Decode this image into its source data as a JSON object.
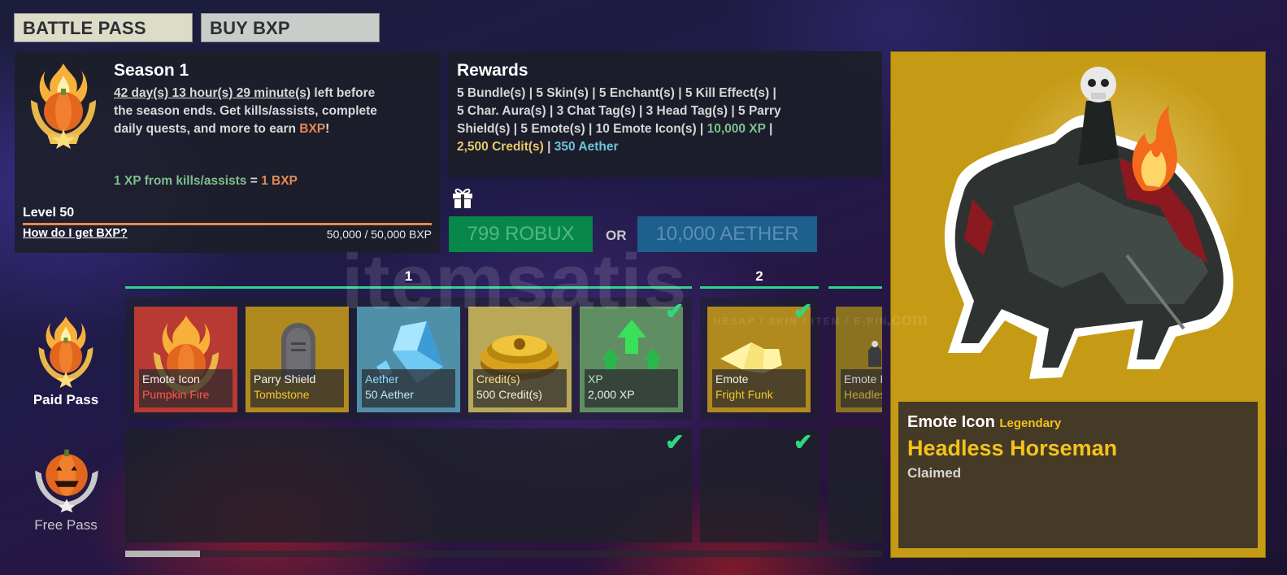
{
  "tabs": [
    {
      "label": "BATTLE PASS",
      "active": true
    },
    {
      "label": "BUY BXP",
      "active": false
    }
  ],
  "season": {
    "title": "Season 1",
    "time_left": "42 day(s) 13 hour(s) 29 minute(s)",
    "text_after_time": " left before the season ends. Get kills/assists, complete daily quests, and more to earn ",
    "bxp_word": "BXP",
    "exclaim": "!",
    "conversion_xp": "1 XP from kills/assists",
    "conversion_eq": " = ",
    "conversion_bxp": "1 BXP",
    "level_label": "Level 50",
    "help_link": "How do I get BXP?",
    "progress_text": "50,000 / 50,000 BXP",
    "progress_fraction": 1.0
  },
  "rewards": {
    "title": "Rewards",
    "line1": "5 Bundle(s) | 5 Skin(s) | 5 Enchant(s) | 5 Kill Effect(s) |",
    "line2": "5 Char. Aura(s) | 3 Chat Tag(s) | 3 Head Tag(s) | 5 Parry",
    "line3a": "Shield(s) | 5 Emote(s) | 10 Emote Icon(s) | ",
    "line3_xp": "10,000 XP",
    "line3b": " |",
    "line4_credits": "2,500 Credit(s)",
    "line4_sep": " | ",
    "line4_aether": "350 Aether"
  },
  "purchase": {
    "robux_label": "799 ROBUX",
    "or_label": "OR",
    "aether_label": "10,000 AETHER"
  },
  "tiers": [
    {
      "label": "1"
    },
    {
      "label": "2"
    }
  ],
  "paid_pass_label": "Paid Pass",
  "free_pass_label": "Free Pass",
  "paid_cards": [
    {
      "type": "Emote Icon",
      "name": "Pumpkin Fire",
      "bg": "#b83a32",
      "name_color": "#ff5a4a",
      "type_color": "#f2f2f2",
      "icon": "pumpkin-emblem-icon"
    },
    {
      "type": "Parry Shield",
      "name": "Tombstone",
      "bg": "#b08a1e",
      "name_color": "#f6c72c",
      "type_color": "#f2f2f2",
      "icon": "tombstone-icon"
    },
    {
      "type": "Aether",
      "name": "50 Aether",
      "bg": "#4f8fa8",
      "name_color": "#bfe7f4",
      "type_color": "#8fdcff",
      "icon": "crystal-icon"
    },
    {
      "type": "Credit(s)",
      "name": "500 Credit(s)",
      "bg": "#b9a857",
      "name_color": "#f4efd6",
      "type_color": "#f6e08a",
      "icon": "coins-icon"
    },
    {
      "type": "XP",
      "name": "2,000 XP",
      "bg": "#5f8e63",
      "name_color": "#e8f3e8",
      "type_color": "#b5e3b5",
      "icon": "xp-arrows-icon"
    },
    {
      "type": "Emote",
      "name": "Fright Funk",
      "bg": "#b08a1e",
      "name_color": "#f6c72c",
      "type_color": "#f2f2f2",
      "icon": "emote-hand-icon"
    },
    {
      "type": "Emote I",
      "name": "Headles",
      "bg": "#8a7220",
      "name_color": "#c9a23a",
      "type_color": "#cfcfcf",
      "icon": "horseman-icon"
    }
  ],
  "detail": {
    "type": "Emote Icon",
    "rarity": "Legendary",
    "name": "Headless Horseman",
    "status": "Claimed",
    "panel_color": "#c59a14",
    "rarity_color": "#f4c21a"
  },
  "watermark": {
    "brand": "itemsatis",
    "tagline": "HESAP / SKIN / ITEM / E-PIN",
    "suffix": ".com"
  }
}
